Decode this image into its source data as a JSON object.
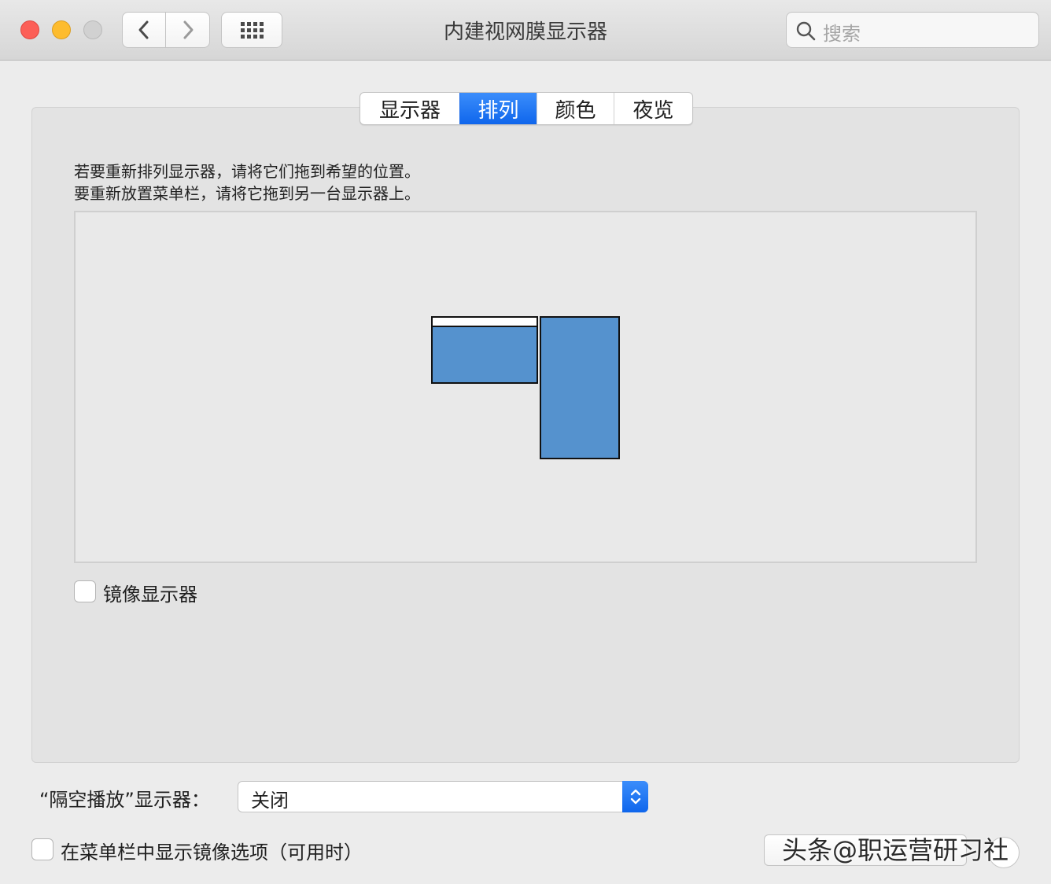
{
  "window": {
    "title": "内建视网膜显示器",
    "search_placeholder": "搜索"
  },
  "toolbar": {
    "back_icon": "chevron-left-icon",
    "forward_icon": "chevron-right-icon",
    "grid_icon": "show-all-grid-icon"
  },
  "tabs": [
    {
      "label": "显示器",
      "active": false
    },
    {
      "label": "排列",
      "active": true
    },
    {
      "label": "颜色",
      "active": false
    },
    {
      "label": "夜览",
      "active": false
    }
  ],
  "instructions": {
    "line1": "若要重新排列显示器，请将它们拖到希望的位置。",
    "line2": "要重新放置菜单栏，请将它拖到另一台显示器上。"
  },
  "arrangement": {
    "display_color": "#5592ce",
    "menubar_color": "#ffffff"
  },
  "mirror": {
    "label": "镜像显示器",
    "checked": false
  },
  "airplay": {
    "label": "“隔空播放”显示器：",
    "value": "关闭"
  },
  "menubar_option": {
    "label": "在菜单栏中显示镜像选项（可用时）",
    "checked": false
  },
  "watermark": "头条@职运营研习社",
  "colors": {
    "accent": "#0f66ec",
    "close": "#fc5f57",
    "minimize": "#fdbc2e",
    "zoom_disabled": "#d1d1d1"
  }
}
